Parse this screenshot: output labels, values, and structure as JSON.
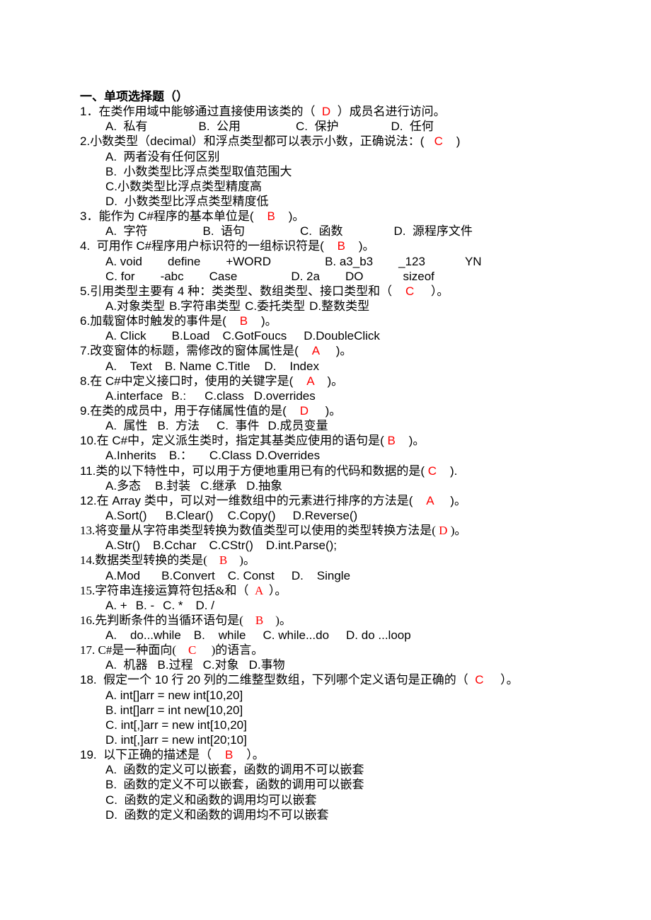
{
  "section_title": "一、单项选择题（）",
  "questions": [
    {
      "num": "1．",
      "pre": "在类作用域中能够通过直接使用该类的（  ",
      "answer": "D",
      "post": "  ）成员名进行访问。",
      "option_lines": [
        [
          "A.  私有",
          "B.  公用",
          "C.  保护",
          "D.  任何"
        ]
      ]
    },
    {
      "num": "2.",
      "pre": "小数类型（decimal）和浮点类型都可以表示小数，正确说法：(   ",
      "answer": "C",
      "post": "    )",
      "option_lines": [
        [
          "A.  两者没有任何区别"
        ],
        [
          "B.  小数类型比浮点类型取值范围大"
        ],
        [
          "C.小数类型比浮点类型精度高"
        ],
        [
          "D.  小数类型比浮点类型精度低"
        ]
      ]
    },
    {
      "num": "3．",
      "pre": "能作为 C#程序的基本单位是(    ",
      "answer": "B",
      "post": "    )。",
      "option_lines": [
        [
          "A.  字符",
          "B.  语句",
          "C.  函数",
          "D.  源程序文件"
        ]
      ]
    },
    {
      "num": "4.",
      "pre": "  可用作 C#程序用户标识符的一组标识符是(    ",
      "answer": "B",
      "post": "    )。",
      "option_lines": [
        [
          "A. void",
          "define",
          "+WORD",
          "B. a3_b3",
          "_123",
          "YN"
        ],
        [
          "C. for",
          "-abc",
          "Case",
          "D. 2a",
          "DO",
          "sizeof"
        ]
      ]
    },
    {
      "num": "5.",
      "pre": "引用类型主要有 4 种：类类型、数组类型、接口类型和（    ",
      "answer": "C",
      "post": "     ）。",
      "option_lines": [
        [
          "A.对象类型",
          "B.字符串类型",
          "C.委托类型",
          "D.整数类型"
        ]
      ]
    },
    {
      "num": "6.",
      "pre": "加载窗体时触发的事件是(    ",
      "answer": "B",
      "post": "    )。",
      "option_lines": [
        [
          "A. Click",
          "B.Load",
          "C.GotFoucs",
          "D.DoubleClick"
        ]
      ]
    },
    {
      "num": "7.",
      "pre": "改变窗体的标题，需修改的窗体属性是(    ",
      "answer": "A",
      "post": "     )。",
      "option_lines": [
        [
          "A.    Text",
          "B. Name",
          "C.Title",
          "D.    Index"
        ]
      ]
    },
    {
      "num": "8.",
      "pre": "在 C#中定义接口时，使用的关键字是(    ",
      "answer": "A",
      "post": "    )。",
      "option_lines": [
        [
          "A.interface",
          "B.:",
          "C.class",
          "D.overrides"
        ]
      ]
    },
    {
      "num": "9.",
      "pre": "在类的成员中，用于存储属性值的是(    ",
      "answer": "D",
      "post": "     )。",
      "option_lines": [
        [
          "A.  属性",
          "B.  方法",
          "C.  事件",
          "D.成员变量"
        ]
      ]
    },
    {
      "num": "10.",
      "pre": "在 C#中，定义派生类时，指定其基类应使用的语句是( ",
      "answer": "B",
      "post": "    )。",
      "option_lines": [
        [
          "A.Inherits",
          "B.：",
          "C.Class",
          "D.Overrides"
        ]
      ]
    },
    {
      "num": "11.",
      "pre": "类的以下特性中，可以用于方便地重用已有的代码和数据的是( ",
      "answer": "C",
      "post": "    ).",
      "option_lines": [
        [
          "A.多态",
          "B.封装",
          "C.继承",
          "D.抽象"
        ]
      ]
    },
    {
      "num": "12.",
      "pre": "在 Array 类中，可以对一维数组中的元素进行排序的方法是(    ",
      "answer": "A",
      "post": "     )。",
      "option_lines": [
        [
          "A.Sort()",
          "B.Clear()",
          "C.Copy()",
          "D.Reverse()"
        ]
      ]
    },
    {
      "num": "13.",
      "pre": "将变量从字符串类型转换为数值类型可以使用的类型转换方法是( ",
      "answer": "D",
      "post": " )。",
      "option_lines": [
        [
          "A.Str()",
          "B.Cchar",
          "C.CStr()",
          "D.int.Parse();"
        ]
      ]
    },
    {
      "num": "14.",
      "pre": "数据类型转换的类是(    ",
      "answer": "B",
      "post": "    )。",
      "option_lines": [
        [
          "A.Mod",
          "B.Convert",
          "C. Const",
          "D.    Single"
        ]
      ]
    },
    {
      "num": "15.",
      "pre": "字符串连接运算符包括&和（  ",
      "answer": "A",
      "post": "  ）。",
      "option_lines": [
        [
          "A. +",
          "B. -",
          "C. *",
          "D. /"
        ]
      ]
    },
    {
      "num": "16.",
      "pre": "先判断条件的当循环语句是(    ",
      "answer": "B",
      "post": "    )。",
      "option_lines": [
        [
          "A.    do...while",
          "B.    while",
          "C. while...do",
          "D. do ...loop"
        ]
      ]
    },
    {
      "num": "17.",
      "pre": " C#是一种面向(    ",
      "answer": "C",
      "post": "     )的语言。",
      "option_lines": [
        [
          "A.  机器",
          "B.过程",
          "C.对象",
          "D.事物"
        ]
      ]
    },
    {
      "num": "18.",
      "pre": "  假定一个 10 行 20 列的二维整型数组，下列哪个定义语句是正确的（  ",
      "answer": "C",
      "post": "     ）。",
      "option_lines": [
        [
          "A. int[]arr = new int[10,20]"
        ],
        [
          "B. int[]arr = int new[10,20]"
        ],
        [
          "C. int[,]arr = new int[10,20]"
        ],
        [
          "D. int[,]arr = new int[20;10]"
        ]
      ]
    },
    {
      "num": "19.",
      "pre": "  以下正确的描述是（    ",
      "answer": "B",
      "post": "    ）。",
      "option_lines": [
        [
          "A.  函数的定义可以嵌套，函数的调用不可以嵌套"
        ],
        [
          "B.  函数的定义不可以嵌套，函数的调用可以嵌套"
        ],
        [
          "C.  函数的定义和函数的调用均可以嵌套"
        ],
        [
          "D.  函数的定义和函数的调用均不可以嵌套"
        ]
      ]
    }
  ]
}
